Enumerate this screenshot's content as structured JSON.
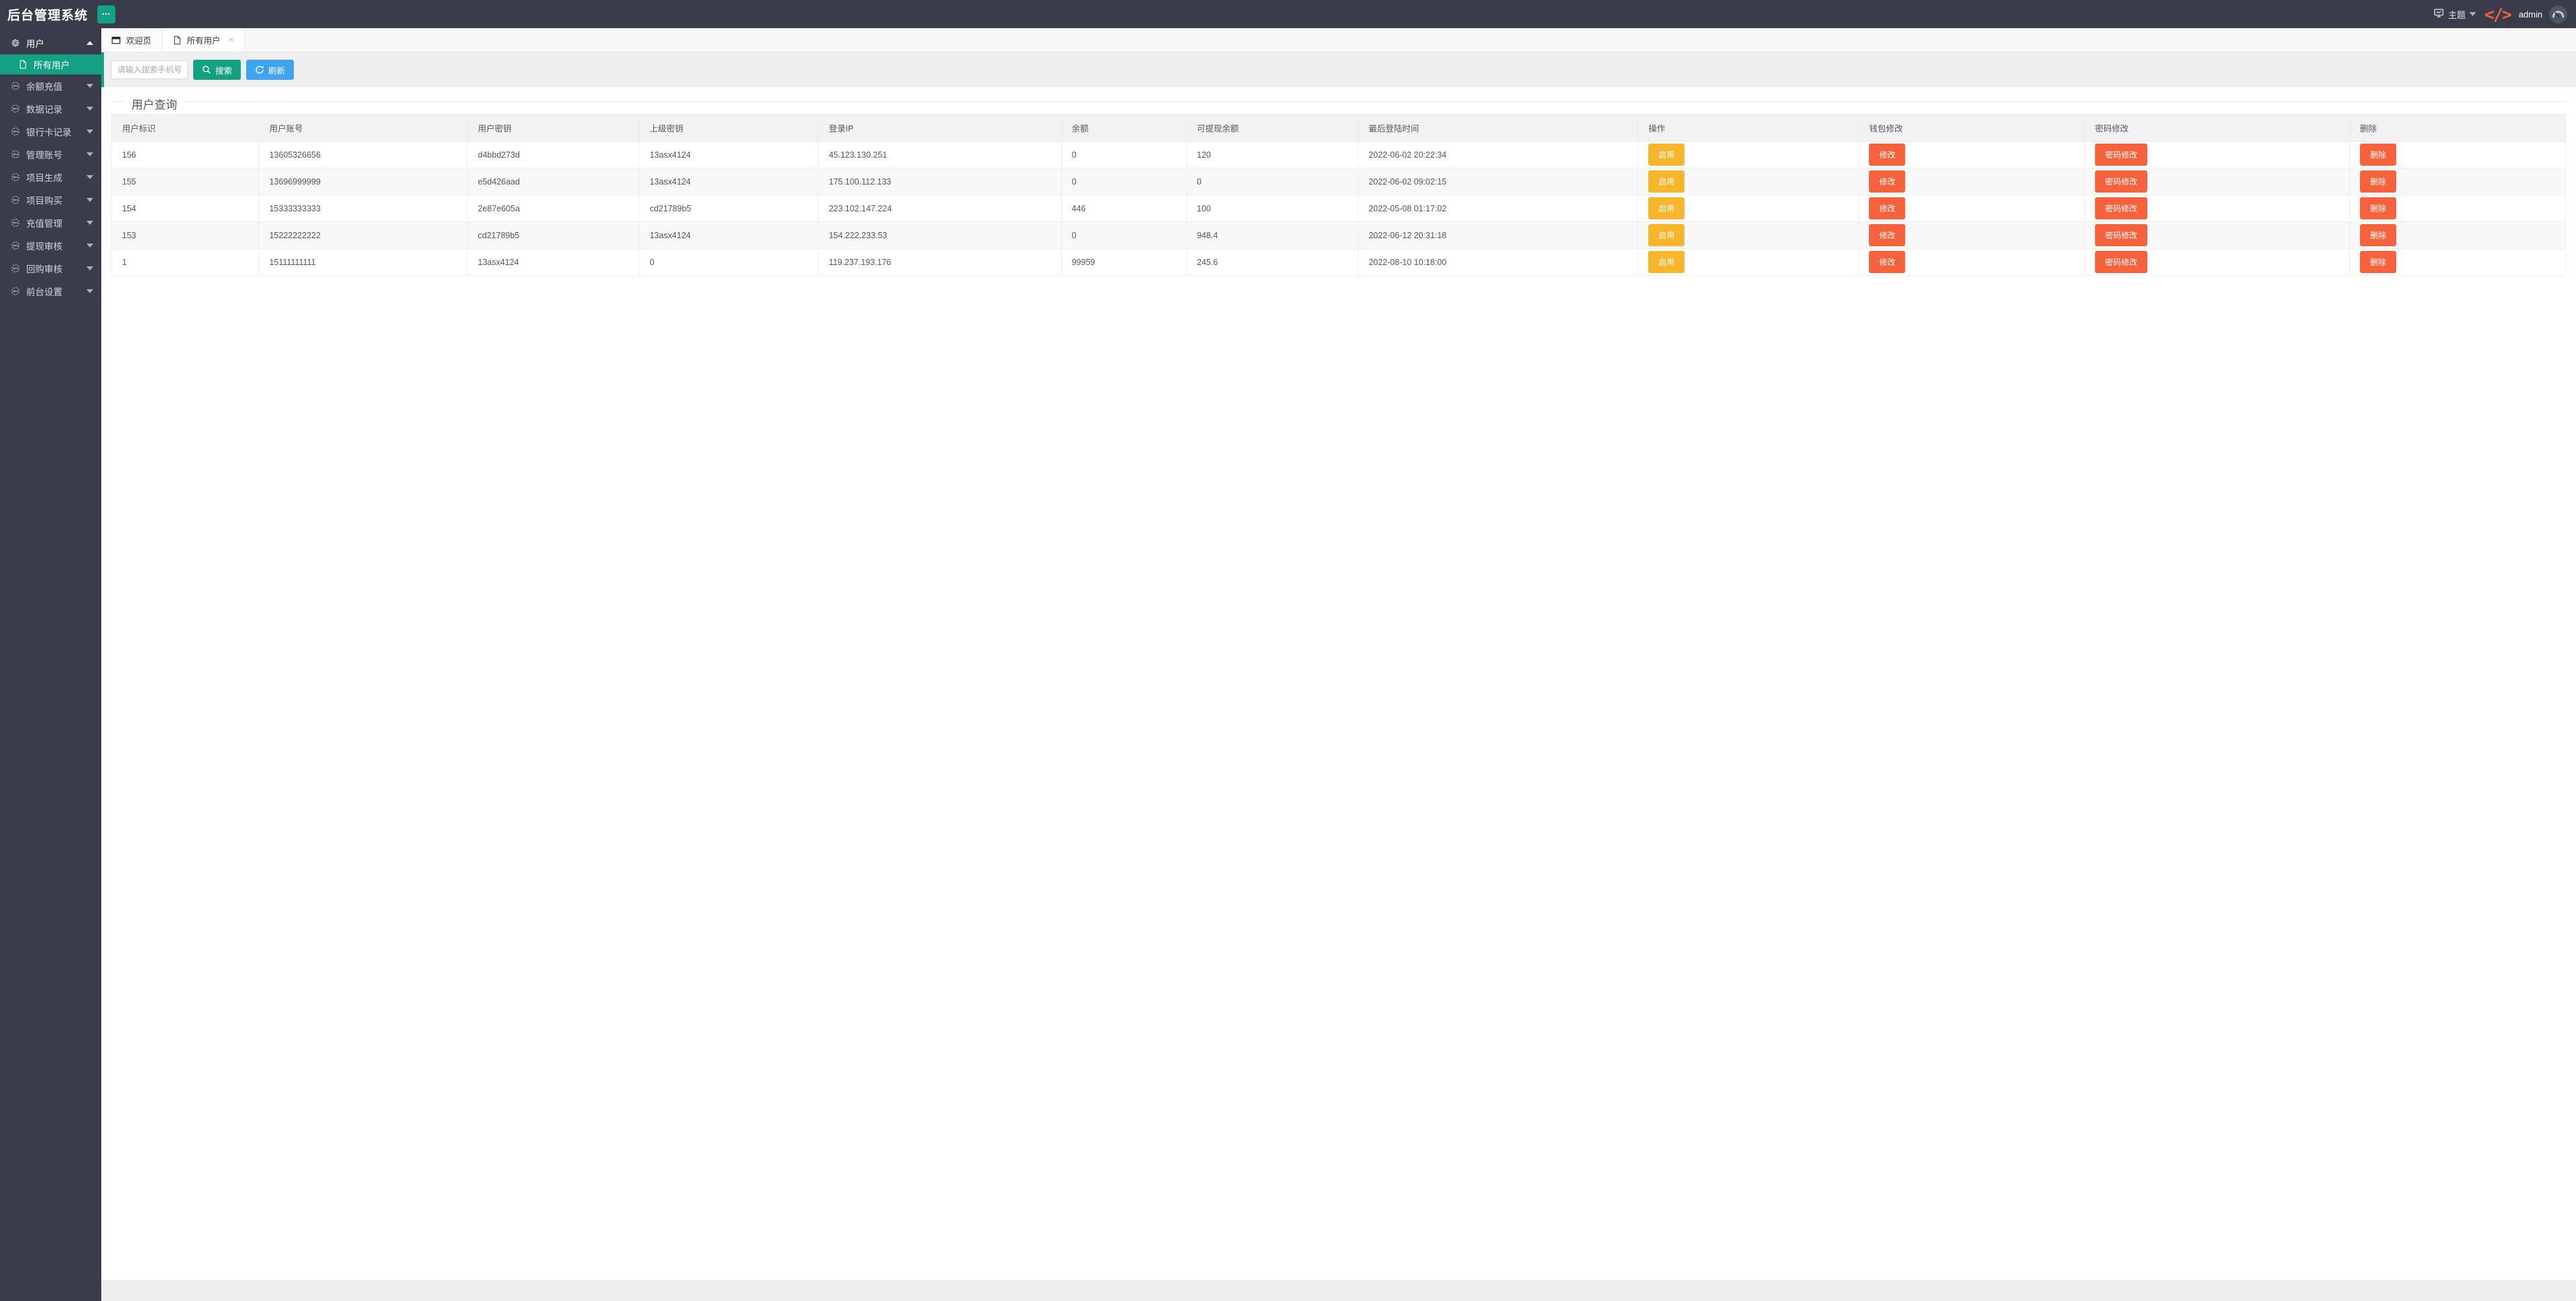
{
  "app": {
    "title": "后台管理系统"
  },
  "header": {
    "menu_dots": "•••",
    "theme_label": "主题",
    "username": "admin"
  },
  "sidebar": {
    "items": [
      {
        "label": "用户",
        "expanded": true,
        "children": [
          {
            "label": "所有用户",
            "active": true
          }
        ]
      },
      {
        "label": "余额充值"
      },
      {
        "label": "数据记录"
      },
      {
        "label": "银行卡记录"
      },
      {
        "label": "管理账号"
      },
      {
        "label": "项目生成"
      },
      {
        "label": "项目购买"
      },
      {
        "label": "充值管理"
      },
      {
        "label": "提现审核"
      },
      {
        "label": "回购审核"
      },
      {
        "label": "前台设置"
      }
    ]
  },
  "tabs": [
    {
      "label": "欢迎页",
      "active": false,
      "closable": false
    },
    {
      "label": "所有用户",
      "active": true,
      "closable": true,
      "close_glyph": "×"
    }
  ],
  "toolbar": {
    "search_placeholder": "请输入搜索手机号",
    "search_value": "",
    "search_label": "搜索",
    "refresh_label": "刷新"
  },
  "main": {
    "section_title": "用户查询",
    "table": {
      "columns": [
        "用户标识",
        "用户账号",
        "用户密钥",
        "上级密钥",
        "登录IP",
        "余额",
        "可提现余额",
        "最后登陆时间",
        "操作",
        "钱包修改",
        "密码修改",
        "删除"
      ],
      "rows": [
        [
          "156",
          "13605326656",
          "d4bbd273d",
          "13asx4124",
          "45.123.130.251",
          "0",
          "120",
          "2022-06-02 20:22:34"
        ],
        [
          "155",
          "13696999999",
          "e5d426aad",
          "13asx4124",
          "175.100.112.133",
          "0",
          "0",
          "2022-06-02 09:02:15"
        ],
        [
          "154",
          "15333333333",
          "2e87e605a",
          "cd21789b5",
          "223.102.147.224",
          "446",
          "100",
          "2022-05-08 01:17:02"
        ],
        [
          "153",
          "15222222222",
          "cd21789b5",
          "13asx4124",
          "154.222.233.53",
          "0",
          "948.4",
          "2022-06-12 20:31:18"
        ],
        [
          "1",
          "15111111111",
          "13asx4124",
          "0",
          "119.237.193.176",
          "99959",
          "245.6",
          "2022-08-10 10:18:00"
        ]
      ],
      "actions": {
        "enable": "启用",
        "wallet_modify": "修改",
        "password_modify": "密码修改",
        "delete": "删除"
      }
    }
  },
  "colors": {
    "nav_dark": "#393D49",
    "accent_teal": "#14A083",
    "refresh_blue": "#3EA4F0",
    "enable_yellow": "#F7B52C",
    "action_orange": "#F5623C",
    "code_glyph_orange": "#F56040"
  }
}
